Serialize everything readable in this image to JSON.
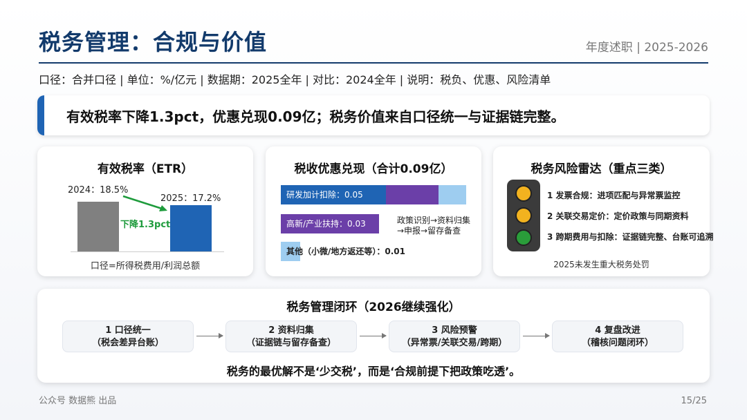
{
  "header": {
    "title": "税务管理：合规与价值",
    "right": "年度述职 | 2025-2026",
    "meta": "口径：合并口径 | 单位：%/亿元 | 数据期：2025全年 | 对比：2024全年 | 说明：税负、优惠、风险清单"
  },
  "headline": "有效税率下降1.3pct，优惠兑现0.09亿；税务价值来自口径统一与证据链完整。",
  "etr": {
    "title": "有效税率（ETR）",
    "label_2024": "2024：18.5%",
    "label_2025": "2025：17.2%",
    "change": "下降1.3pct",
    "note": "口径=所得税费用/利润总额",
    "colors": {
      "y2024": "#808080",
      "y2025": "#1f64b4",
      "arrow": "#1e9b3c"
    }
  },
  "chart_data": {
    "type": "bar",
    "categories": [
      "2024",
      "2025"
    ],
    "values": [
      18.5,
      17.2
    ]
  },
  "incentives": {
    "title": "税收优惠兑现（合计0.09亿）",
    "rows": [
      {
        "label": "研发加计扣除：0.05",
        "value": 0.05,
        "color": "#1f64b4"
      },
      {
        "label": "高新/产业扶持：0.03",
        "value": 0.03,
        "color": "#6b3fa8"
      },
      {
        "label": "其他（小微/地方返还等）：0.01",
        "value": 0.01,
        "color": "#9ecdf0"
      }
    ],
    "note_line1": "政策识别→资料归集",
    "note_line2": "→申报→留存备查"
  },
  "risk": {
    "title": "税务风险雷达（重点三类）",
    "items": [
      {
        "text": "1 发票合规：进项匹配与异常票监控",
        "color": "#f2b21f"
      },
      {
        "text": "2 关联交易定价：定价政策与同期资料",
        "color": "#f2b21f"
      },
      {
        "text": "3 跨期费用与扣除：证据链完整、台账可追溯",
        "color": "#2a9d3a"
      }
    ],
    "foot": "2025未发生重大税务处罚"
  },
  "loop": {
    "title": "税务管理闭环（2026继续强化）",
    "steps": [
      {
        "l1": "1 口径统一",
        "l2": "（税会差异台账）"
      },
      {
        "l1": "2 资料归集",
        "l2": "（证据链与留存备查）"
      },
      {
        "l1": "3 风险预警",
        "l2": "（异常票/关联交易/跨期）"
      },
      {
        "l1": "4 复盘改进",
        "l2": "（稽核问题闭环）"
      }
    ],
    "quote": "税务的最优解不是‘少交税’，而是‘合规前提下把政策吃透’。"
  },
  "footer": {
    "left": "公众号 数据熊 出品",
    "page": "15/25"
  }
}
